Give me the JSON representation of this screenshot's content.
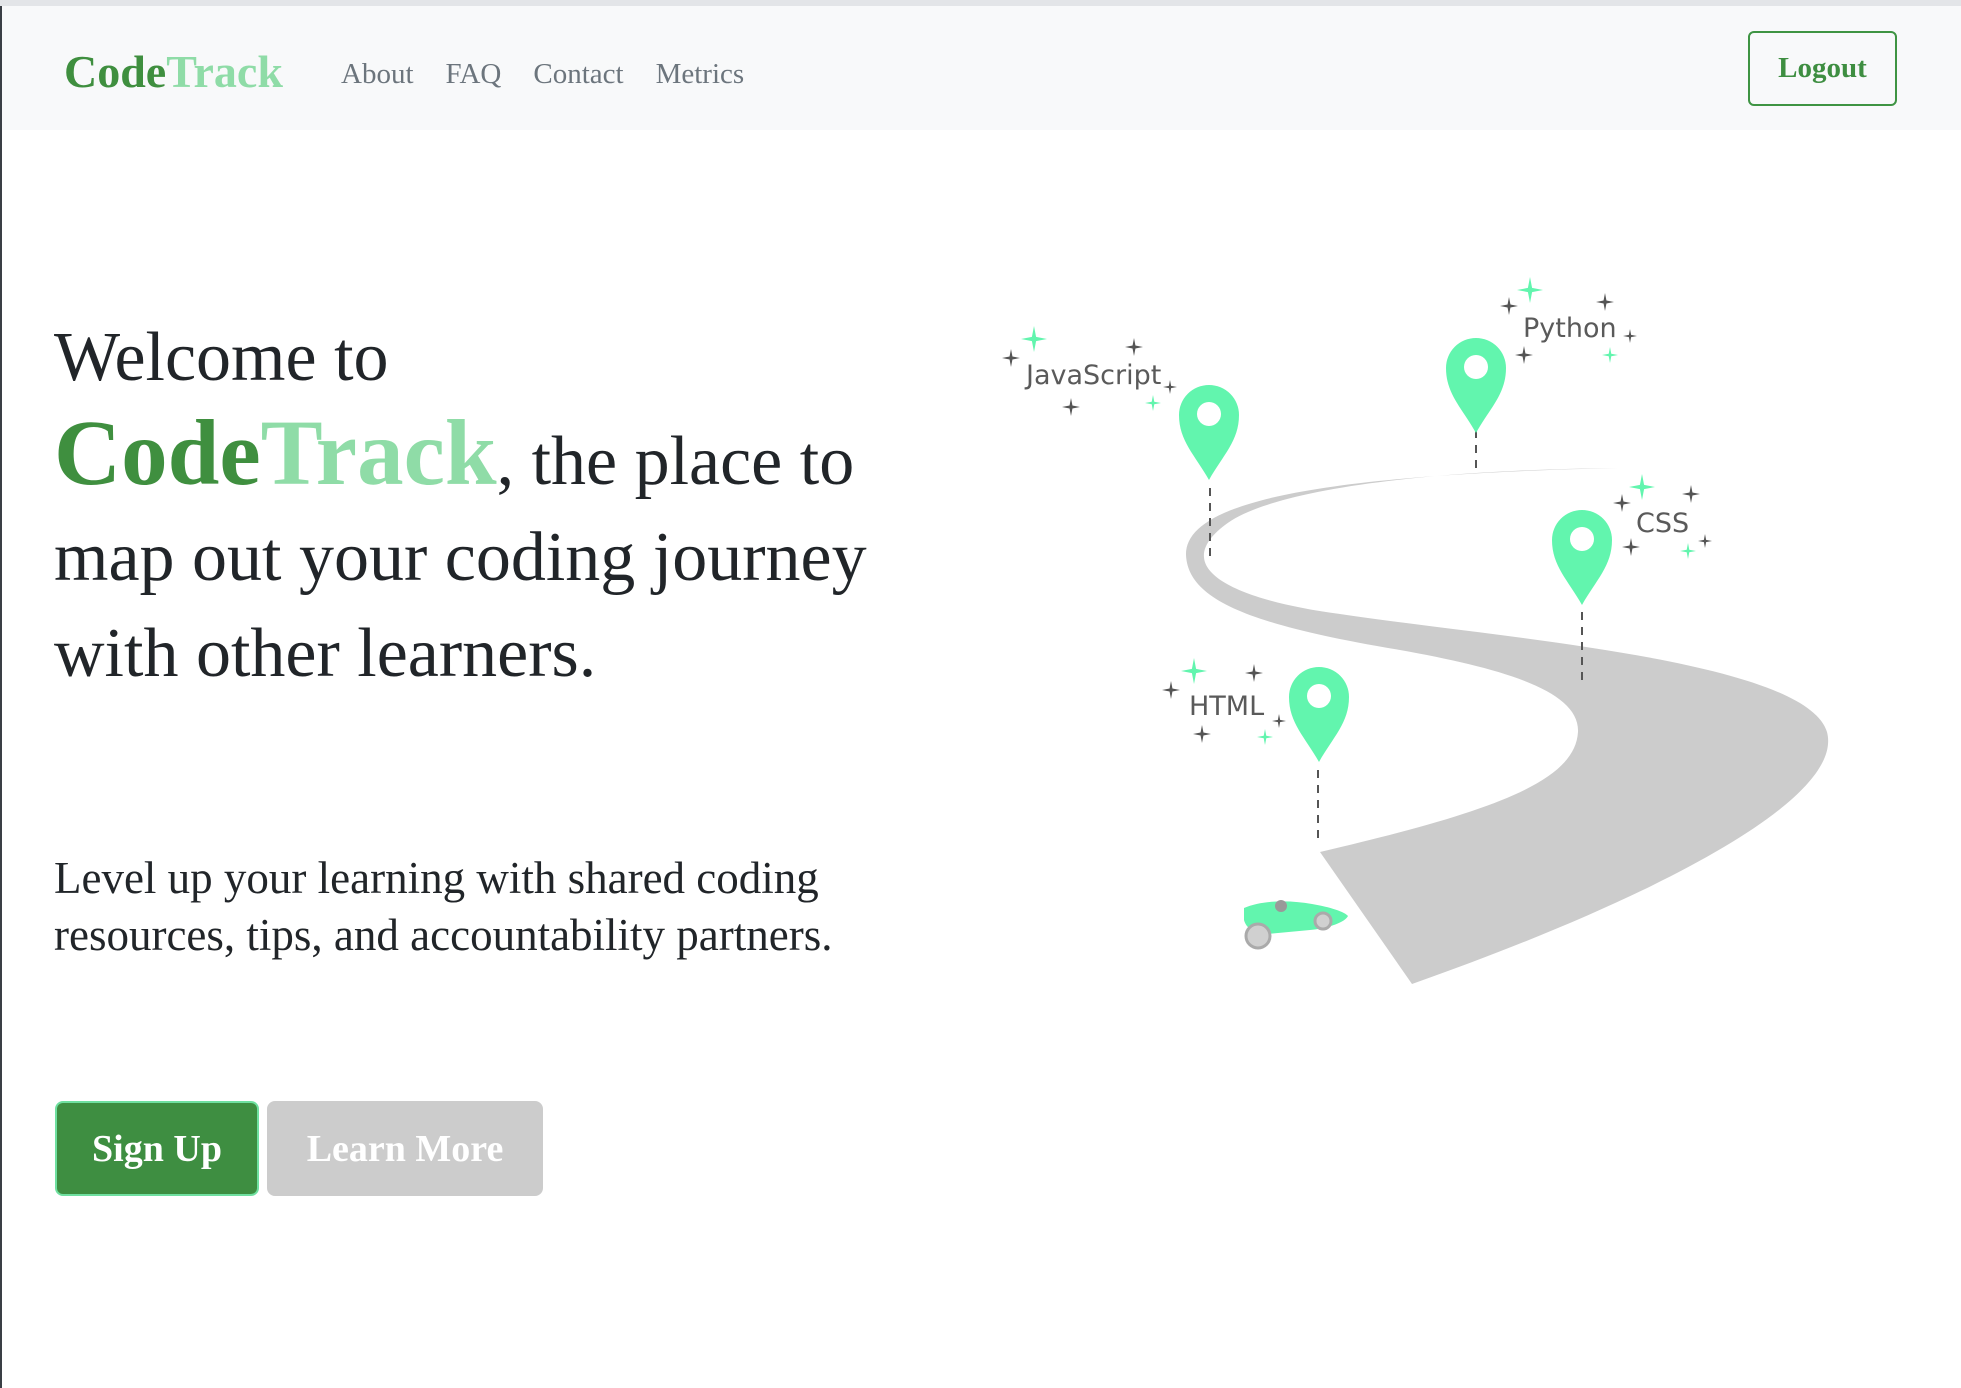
{
  "navbar": {
    "brand": {
      "part1": "Code",
      "part2": "Track"
    },
    "links": [
      "About",
      "FAQ",
      "Contact",
      "Metrics"
    ],
    "logout_label": "Logout"
  },
  "hero": {
    "title_prefix": "Welcome to",
    "brand_part1": "Code",
    "brand_part2": "Track",
    "title_suffix": ", the place to map out your coding journey with other learners.",
    "subtitle": "Level up your learning with shared coding resources, tips, and accountability partners.",
    "signup_label": "Sign Up",
    "learn_more_label": "Learn More"
  },
  "illustration": {
    "milestones": [
      "JavaScript",
      "Python",
      "CSS",
      "HTML"
    ]
  },
  "colors": {
    "primary_green": "#3e8e41",
    "light_green": "#8fdca7",
    "pin_green": "#62f5ae",
    "road_gray": "#cccccc"
  }
}
